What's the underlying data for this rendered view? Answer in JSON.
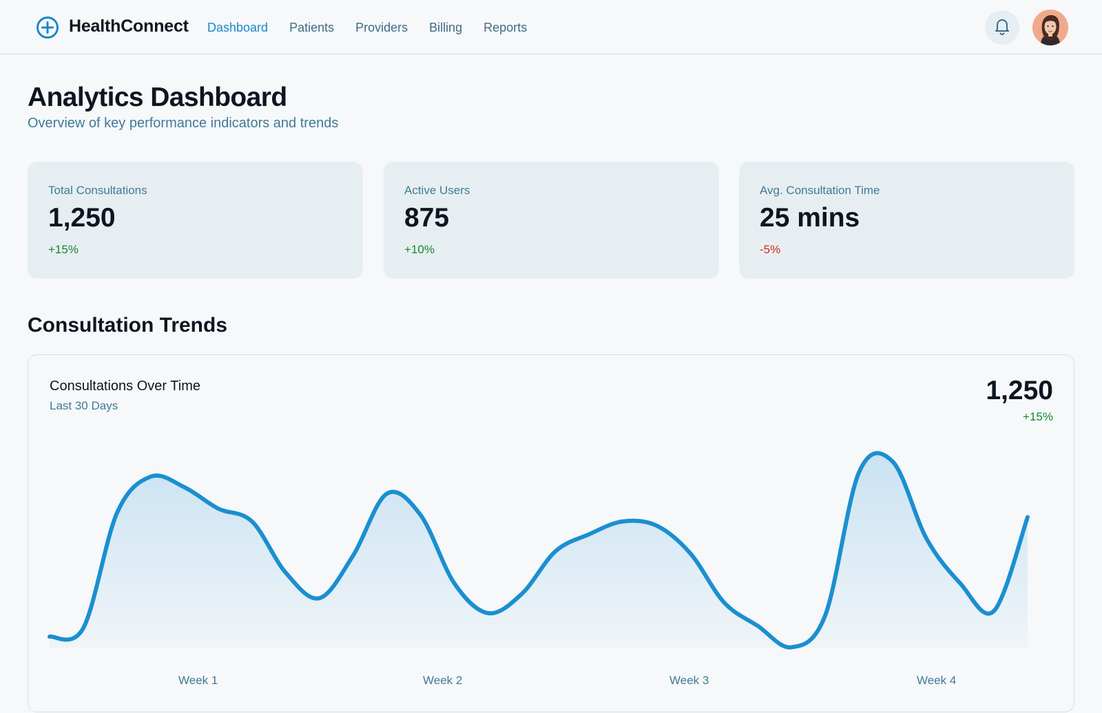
{
  "app": {
    "brand": "HealthConnect",
    "accent_color": "#1b87c9",
    "logo_icon": "plus-circle-icon"
  },
  "nav": {
    "items": [
      {
        "label": "Dashboard",
        "active": true
      },
      {
        "label": "Patients",
        "active": false
      },
      {
        "label": "Providers",
        "active": false
      },
      {
        "label": "Billing",
        "active": false
      },
      {
        "label": "Reports",
        "active": false
      }
    ],
    "notification_icon": "bell-icon",
    "avatar": "user-avatar"
  },
  "page": {
    "title": "Analytics Dashboard",
    "subtitle": "Overview of key performance indicators and trends"
  },
  "kpis": [
    {
      "label": "Total Consultations",
      "value": "1,250",
      "delta": "+15%",
      "trend": "up"
    },
    {
      "label": "Active Users",
      "value": "875",
      "delta": "+10%",
      "trend": "up"
    },
    {
      "label": "Avg. Consultation Time",
      "value": "25 mins",
      "delta": "-5%",
      "trend": "down"
    }
  ],
  "section": {
    "title": "Consultation Trends"
  },
  "chart": {
    "title": "Consultations Over Time",
    "period": "Last 30 Days",
    "total": "1,250",
    "delta": "+15%",
    "line_color": "#1b8fd0"
  },
  "chart_data": {
    "type": "area",
    "title": "Consultations Over Time",
    "subtitle": "Last 30 Days",
    "categories": [
      "Week 1",
      "Week 2",
      "Week 3",
      "Week 4"
    ],
    "x": [
      0,
      1,
      2,
      3,
      4,
      5,
      6,
      7,
      8,
      9,
      10,
      11,
      12,
      13,
      14,
      15,
      16,
      17,
      18,
      19,
      20,
      21,
      22,
      23,
      24,
      25,
      26,
      27,
      28,
      29
    ],
    "values": [
      10,
      14,
      68,
      85,
      80,
      70,
      64,
      40,
      28,
      48,
      77,
      67,
      35,
      21,
      30,
      50,
      58,
      64,
      62,
      49,
      26,
      15,
      5,
      20,
      87,
      92,
      56,
      35,
      22,
      66
    ],
    "ylim": [
      0,
      100
    ],
    "grid": false,
    "legend": "none"
  }
}
